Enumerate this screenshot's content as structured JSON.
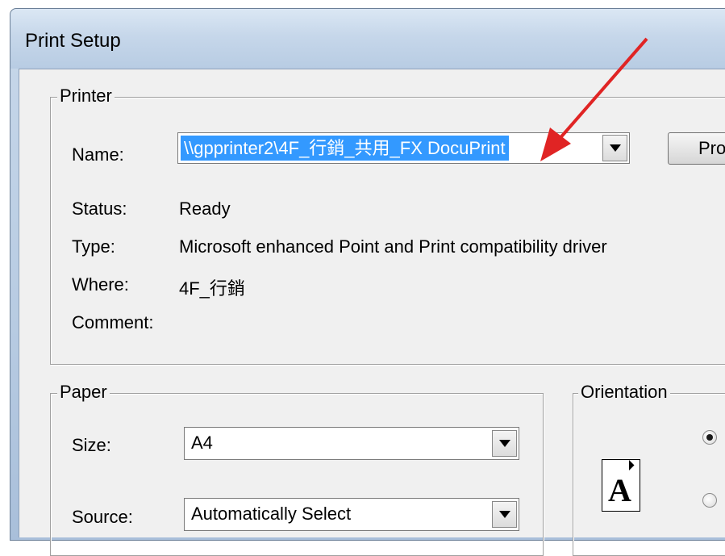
{
  "window": {
    "title": "Print Setup"
  },
  "printer": {
    "group_label": "Printer",
    "name_label": "Name:",
    "name_value": "\\\\gpprinter2\\4F_行銷_共用_FX DocuPrint",
    "properties_label": "Properties...",
    "properties_visible": "Pro",
    "status_label": "Status:",
    "status_value": "Ready",
    "type_label": "Type:",
    "type_value": "Microsoft enhanced Point and Print compatibility driver",
    "where_label": "Where:",
    "where_value": "4F_行銷",
    "comment_label": "Comment:",
    "comment_value": ""
  },
  "paper": {
    "group_label": "Paper",
    "size_label": "Size:",
    "size_value": "A4",
    "source_label": "Source:",
    "source_value": "Automatically Select"
  },
  "orientation": {
    "group_label": "Orientation",
    "icon_glyph": "A",
    "selected": "portrait"
  },
  "colors": {
    "selection": "#3399ff",
    "arrow": "#e02424"
  },
  "icons": {
    "dropdown": "chevron-down-icon",
    "page": "page-portrait-icon"
  }
}
